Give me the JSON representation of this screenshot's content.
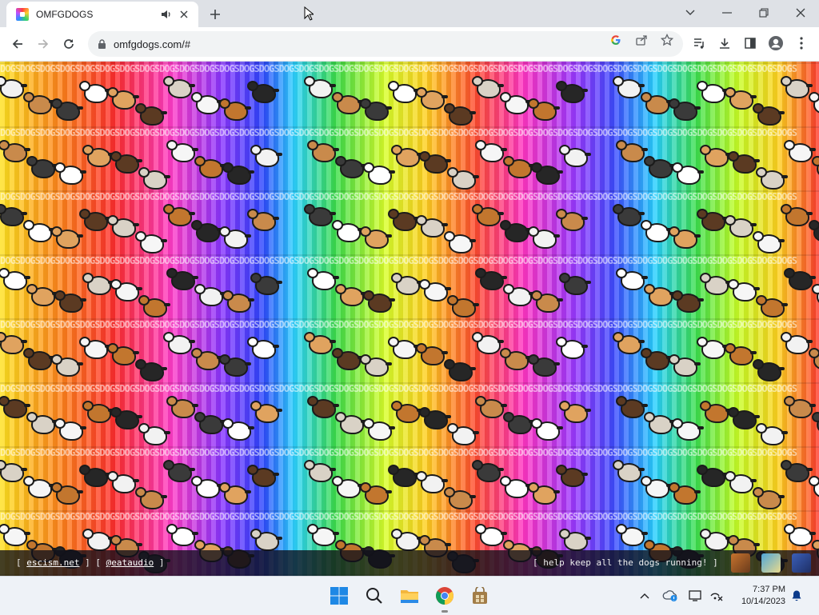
{
  "browser": {
    "tab": {
      "title": "OMFGDOGS",
      "audio_icon": "speaker-icon",
      "close_icon": "close-icon"
    },
    "new_tab_icon": "plus-icon",
    "window_controls": [
      "chevron-down-icon",
      "minimize-icon",
      "restore-icon",
      "close-icon"
    ],
    "nav": [
      "back-icon",
      "forward-icon",
      "reload-icon"
    ],
    "omnibox": {
      "url": "omfgdogs.com/#",
      "lock_icon": "lock-icon"
    },
    "omnibox_icons": [
      "google-icon",
      "share-icon",
      "star-icon"
    ],
    "toolbar_icons": [
      "media-icon",
      "download-icon",
      "sidepanel-icon",
      "profile-icon",
      "menu-icon"
    ]
  },
  "page": {
    "banner_word": "DOGS",
    "footer": {
      "left_open": "[ ",
      "link1": "escism.net",
      "middle": " ] [ ",
      "link2": "@eataudio",
      "left_close": " ]",
      "right": "[ help keep all the dogs running! ]"
    }
  },
  "taskbar": {
    "apps": [
      "windows-start-icon",
      "search-icon",
      "file-explorer-icon",
      "chrome-icon",
      "store-icon"
    ],
    "tray": [
      "chevron-up-icon",
      "onedrive-icon",
      "display-icon",
      "network-muted-icon",
      "notifications-icon"
    ],
    "time": "7:37 PM",
    "date": "10/14/2023"
  },
  "colors": {
    "tabstrip": "#dee1e6",
    "omnibox": "#f1f3f4",
    "taskbar": "#eef2f7",
    "footer_bg": "#0f0f19"
  }
}
